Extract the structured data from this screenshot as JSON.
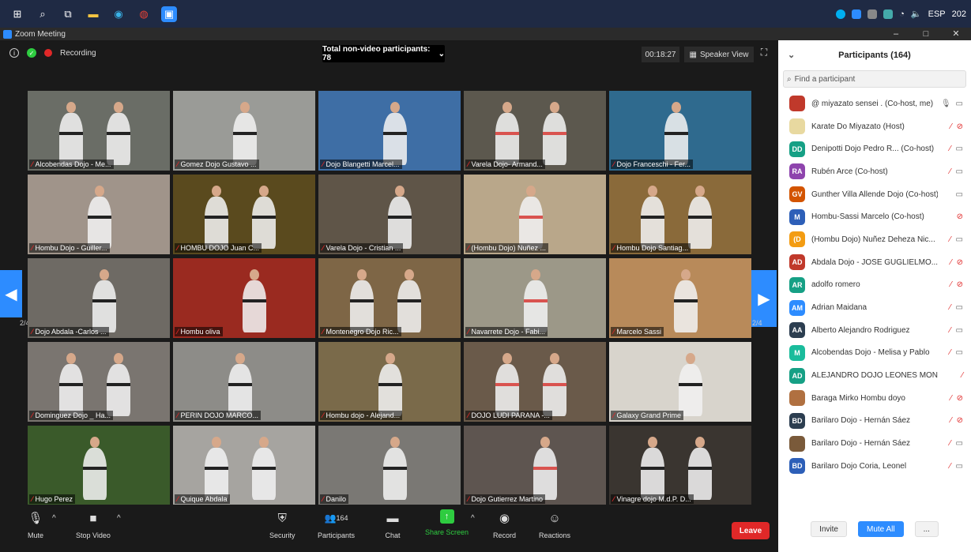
{
  "taskbar": {
    "icons": [
      "windows-start-icon",
      "search-icon",
      "task-view-icon",
      "file-explorer-icon",
      "edge-icon",
      "chrome-icon",
      "zoom-icon"
    ],
    "tray": {
      "lang": "ESP",
      "year": "202"
    }
  },
  "window": {
    "title": "Zoom Meeting",
    "minimize": "–",
    "maximize": "□",
    "close": "✕"
  },
  "topbar": {
    "recording": "Recording",
    "nonvideo": "Total non-video participants: 78",
    "timer": "00:18:27",
    "speaker_view": "Speaker View"
  },
  "colors": {
    "accent": "#2d8cff",
    "mic_muted": "#e02828",
    "leave": "#e02828"
  },
  "grid": {
    "page_left": "2/4",
    "page_right": "2/4",
    "tiles": [
      {
        "label": "Alcobendas Dojo - Me...",
        "bg": "#6a6d66"
      },
      {
        "label": "Gomez Dojo Gustavo ...",
        "bg": "#9a9b97"
      },
      {
        "label": "Dojo Blangetti Marcel...",
        "bg": "#3e6ea5"
      },
      {
        "label": "Varela Dojo- Armand...",
        "bg": "#5c584e"
      },
      {
        "label": "Dojo Franceschi - Fer...",
        "bg": "#2f6a8e"
      },
      {
        "label": "Hombu Dojo - Guiller...",
        "bg": "#a0948a"
      },
      {
        "label": "HOMBU DOJO Juan C...",
        "bg": "#5a4a1e"
      },
      {
        "label": "Varela Dojo - Cristian ...",
        "bg": "#5f5548"
      },
      {
        "label": "(Hombu Dojo) Nuñez ...",
        "bg": "#b9a78a"
      },
      {
        "label": "Hombu Dojo Santiag...",
        "bg": "#8a6a3a"
      },
      {
        "label": "Dojo Abdala -Carlos ...",
        "bg": "#6e6a64"
      },
      {
        "label": "Hombu oliva",
        "bg": "#9a2a20"
      },
      {
        "label": "Montenegro Dojo Ric...",
        "bg": "#7e6646"
      },
      {
        "label": "Navarrete Dojo - Fabi...",
        "bg": "#9c9888"
      },
      {
        "label": "Marcelo Sassi",
        "bg": "#b88a5a"
      },
      {
        "label": "Dominguez Dojo _ Ha...",
        "bg": "#7a7570"
      },
      {
        "label": "PERIN DOJO MARCO...",
        "bg": "#8d8c88"
      },
      {
        "label": "Hombu dojo - Alejand...",
        "bg": "#7a6a4a"
      },
      {
        "label": "DOJO LUDI PARANA -...",
        "bg": "#6a5a4a"
      },
      {
        "label": "Galaxy Grand Prime",
        "bg": "#d8d4cc"
      },
      {
        "label": "Hugo Perez",
        "bg": "#3a5a2a"
      },
      {
        "label": "Quique Abdala",
        "bg": "#a6a4a0"
      },
      {
        "label": "Danilo",
        "bg": "#7a7874"
      },
      {
        "label": "Dojo Gutierrez Martino",
        "bg": "#5e5550"
      },
      {
        "label": "Vinagre dojo M.d.P. D...",
        "bg": "#3a3530"
      }
    ]
  },
  "toolbar": {
    "mute": "Mute",
    "stop_video": "Stop Video",
    "security": "Security",
    "participants": "Participants",
    "participants_count": "164",
    "chat": "Chat",
    "share_screen": "Share Screen",
    "record": "Record",
    "reactions": "Reactions",
    "leave": "Leave"
  },
  "panel": {
    "title": "Participants (164)",
    "search_placeholder": "Find a participant",
    "invite": "Invite",
    "mute_all": "Mute All",
    "more": "..."
  },
  "participants": [
    {
      "initials": "",
      "name": "@ miyazato sensei . (Co-host, me)",
      "color": "#c0392b",
      "mic": "on",
      "video": "on"
    },
    {
      "initials": "",
      "name": "Karate Do Miyazato (Host)",
      "color": "#e8d9a0",
      "mic": "muted",
      "video": "muted"
    },
    {
      "initials": "DD",
      "name": "Denipotti Dojo Pedro R... (Co-host)",
      "color": "#16a085",
      "mic": "muted",
      "video": "on"
    },
    {
      "initials": "RA",
      "name": "Rubén Arce (Co-host)",
      "color": "#8e44ad",
      "mic": "muted",
      "video": "on"
    },
    {
      "initials": "GV",
      "name": "Gunther Villa Allende Dojo (Co-host)",
      "color": "#d35400",
      "mic": "",
      "video": "on"
    },
    {
      "initials": "M",
      "name": "Hombu-Sassi Marcelo (Co-host)",
      "color": "#2d5fb8",
      "mic": "",
      "video": "muted"
    },
    {
      "initials": "(D",
      "name": "(Hombu Dojo) Nuñez Deheza Nic...",
      "color": "#f39c12",
      "mic": "muted",
      "video": "on"
    },
    {
      "initials": "AD",
      "name": "Abdala Dojo - JOSE GUGLIELMO...",
      "color": "#c0392b",
      "mic": "muted",
      "video": "muted"
    },
    {
      "initials": "AR",
      "name": "adolfo romero",
      "color": "#16a085",
      "mic": "muted",
      "video": "muted"
    },
    {
      "initials": "AM",
      "name": "Adrian Maidana",
      "color": "#2d8cff",
      "mic": "muted",
      "video": "on"
    },
    {
      "initials": "AA",
      "name": "Alberto Alejandro Rodriguez",
      "color": "#2c3e50",
      "mic": "muted",
      "video": "on"
    },
    {
      "initials": "M",
      "name": "Alcobendas Dojo - Melisa y Pablo",
      "color": "#1abc9c",
      "mic": "muted",
      "video": "on"
    },
    {
      "initials": "AD",
      "name": "ALEJANDRO DOJO LEONES MONTE...",
      "color": "#16a085",
      "mic": "muted",
      "video": ""
    },
    {
      "initials": "",
      "name": "Baraga Mirko Hombu doyo",
      "color": "#b07040",
      "mic": "muted",
      "video": "muted"
    },
    {
      "initials": "BD",
      "name": "Barilaro Dojo - Hernán Sáez",
      "color": "#2c3e50",
      "mic": "muted",
      "video": "muted"
    },
    {
      "initials": "",
      "name": "Barilaro Dojo - Hernán Sáez",
      "color": "#7a5a3a",
      "mic": "muted",
      "video": "on"
    },
    {
      "initials": "BD",
      "name": "Barilaro Dojo Coria, Leonel",
      "color": "#2d5fb8",
      "mic": "muted",
      "video": "on"
    }
  ]
}
